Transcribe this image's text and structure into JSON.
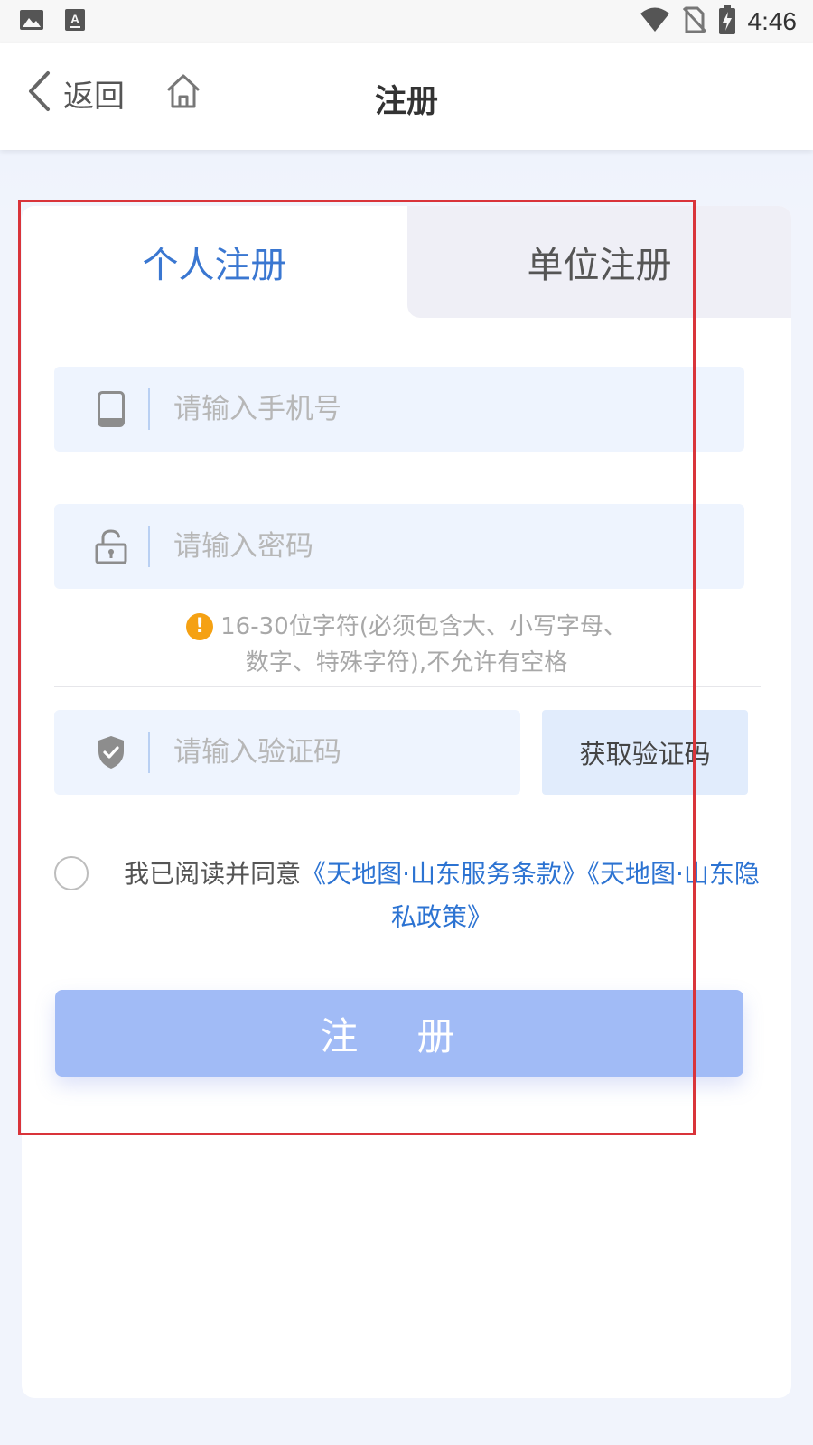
{
  "status_bar": {
    "time": "4:46",
    "left_icons": [
      "image-icon",
      "text-a-icon"
    ],
    "right_icons": [
      "wifi-icon",
      "no-sim-icon",
      "battery-charging-icon"
    ]
  },
  "nav": {
    "back_label": "返回",
    "title": "注册"
  },
  "tabs": {
    "personal": "个人注册",
    "company": "单位注册",
    "active": "personal"
  },
  "form": {
    "phone": {
      "placeholder": "请输入手机号",
      "value": "",
      "icon": "phone-icon"
    },
    "password": {
      "placeholder": "请输入密码",
      "value": "",
      "icon": "unlock-icon"
    },
    "password_hint_line1": "16-30位字符(必须包含大、小写字母、",
    "password_hint_line2": "数字、特殊字符),不允许有空格",
    "code": {
      "placeholder": "请输入验证码",
      "value": "",
      "icon": "shield-check-icon"
    },
    "get_code_label": "获取验证码"
  },
  "agreement": {
    "prefix": "我已阅读并同意",
    "terms_link": "《天地图·山东服务条款》",
    "privacy_link": "《天地图·山东隐私政策》",
    "checked": false
  },
  "submit_label": "注 册",
  "colors": {
    "accent": "#3a77d1",
    "link": "#2c73d2",
    "submit_bg": "#a1bbf6",
    "field_bg": "#eef4fe",
    "warning": "#f5a113",
    "highlight": "#d9343a"
  }
}
